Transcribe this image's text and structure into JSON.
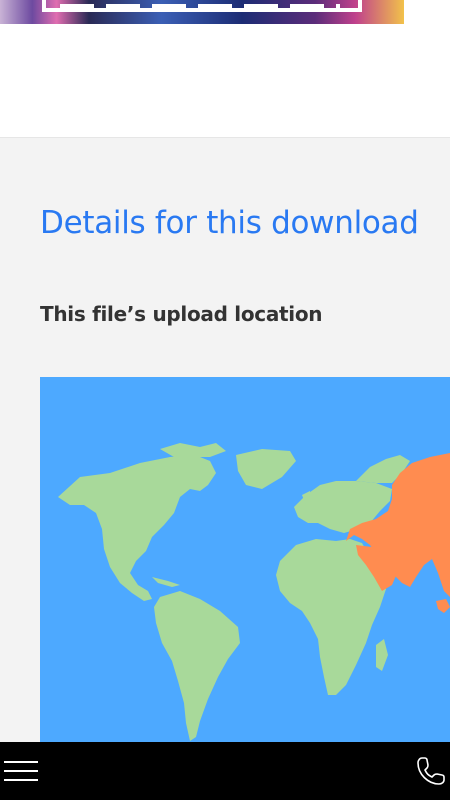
{
  "banner": {
    "icon": "promo-banner-image"
  },
  "details": {
    "title": "Details for this download",
    "upload_location_label": "This file’s upload location"
  },
  "map": {
    "highlighted_region": "Asia",
    "colors": {
      "ocean": "#4da9ff",
      "land": "#a8d99a",
      "highlight": "#ff8c50"
    }
  },
  "bottom_bar": {
    "menu_icon": "hamburger-menu-icon",
    "phone_icon": "phone-icon"
  }
}
